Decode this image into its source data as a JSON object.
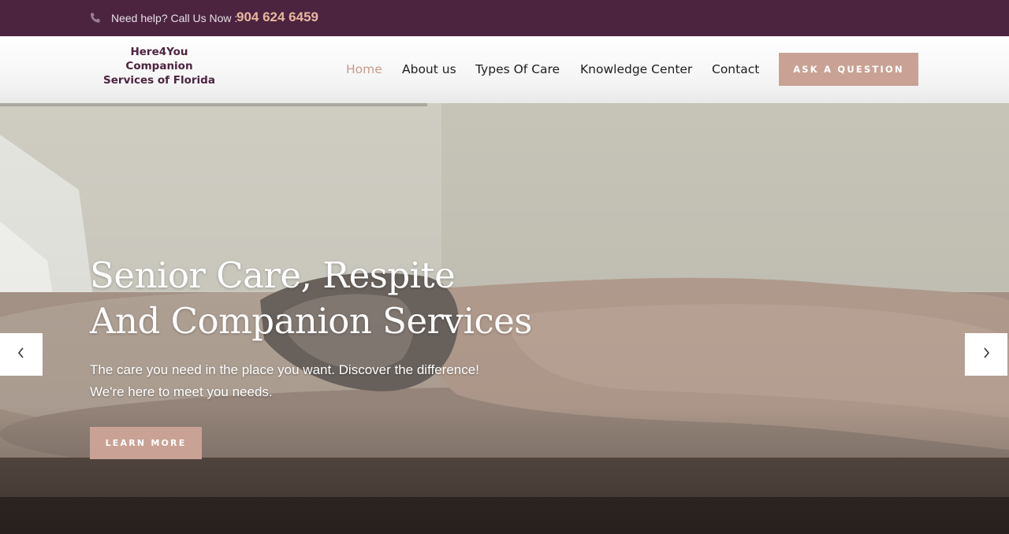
{
  "topbar": {
    "help_text": "Need help? Call Us Now :",
    "phone_number": "904 624 6459",
    "phone_icon": "phone-icon"
  },
  "header": {
    "logo_lines": [
      "Here4You",
      "Companion",
      "Services of Florida"
    ],
    "nav": [
      {
        "label": "Home",
        "active": true
      },
      {
        "label": "About us",
        "active": false
      },
      {
        "label": "Types Of Care",
        "active": false
      },
      {
        "label": "Knowledge Center",
        "active": false
      },
      {
        "label": "Contact",
        "active": false
      }
    ],
    "cta_label": "ASK A QUESTION"
  },
  "hero": {
    "title_lines": [
      "Senior Care, Respite",
      "And Companion Services"
    ],
    "subtitle_lines": [
      "The care you need in the place you want. Discover the difference!",
      "We're here to meet you needs."
    ],
    "button_label": "LEARN MORE",
    "prev_icon": "chevron-left-icon",
    "next_icon": "chevron-right-icon"
  },
  "colors": {
    "brand_purple": "#4c2440",
    "accent_rose": "#c9a295",
    "phone_highlight": "#e7b79f",
    "active_nav": "#c99b8f"
  }
}
